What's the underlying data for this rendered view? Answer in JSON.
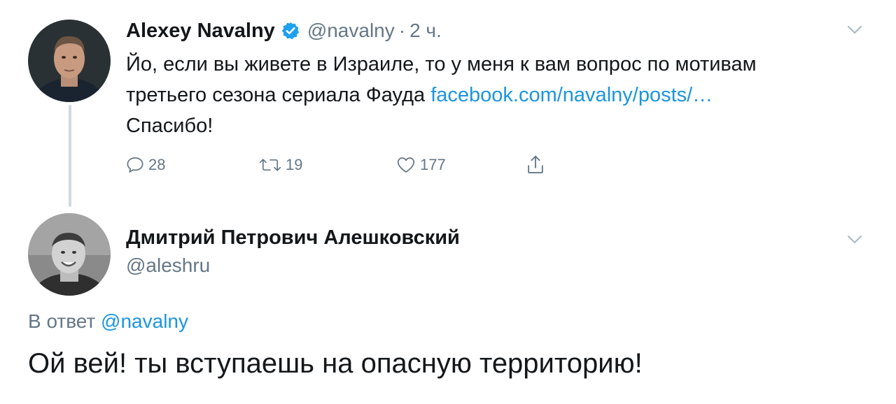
{
  "tweet": {
    "author": {
      "name": "Alexey Navalny",
      "handle": "@navalny",
      "verified": true
    },
    "separator": "·",
    "time": "2 ч.",
    "text_line1": "Йо, если вы живете в Израиле, то у меня к вам вопрос по мотивам",
    "text_line2": "третьего сезона сериала Фауда ",
    "link": "facebook.com/navalny/posts/…",
    "text_line3": "Спасибо!",
    "actions": {
      "reply_count": "28",
      "retweet_count": "19",
      "like_count": "177"
    }
  },
  "reply": {
    "author": {
      "name": "Дмитрий Петрович Алешковский",
      "handle": "@aleshru"
    },
    "reply_to_label": "В ответ ",
    "reply_to_mention": "@navalny",
    "text": "Ой вей! ты вступаешь на опасную территорию!"
  },
  "colors": {
    "link": "#1b95e0",
    "secondary_text": "#657786",
    "verified": "#1da1f2",
    "thread_line": "#cfd9de"
  },
  "icons": [
    "verified-badge-icon",
    "chevron-down-icon",
    "reply-icon",
    "retweet-icon",
    "like-icon",
    "share-icon"
  ]
}
